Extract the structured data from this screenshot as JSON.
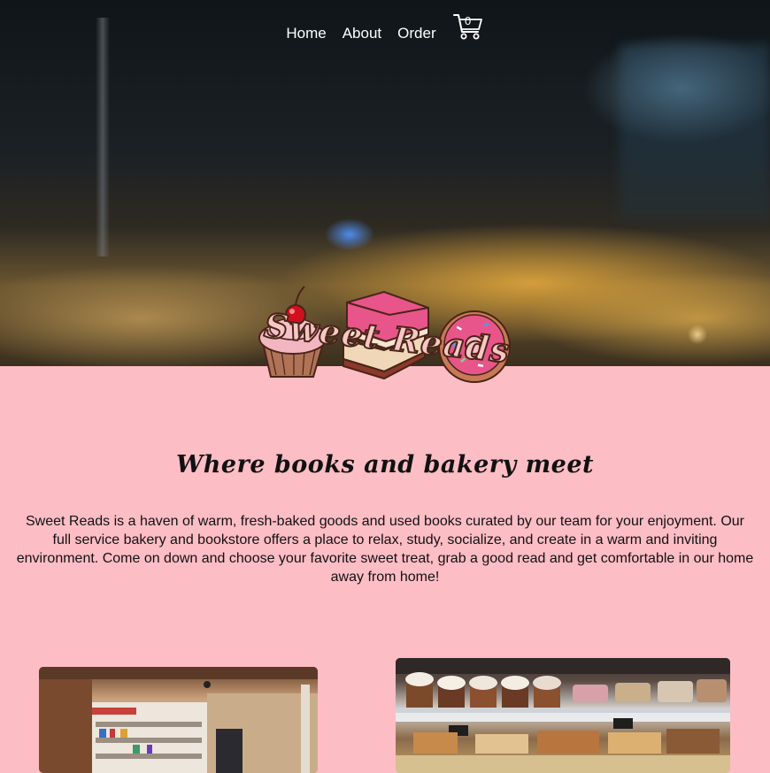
{
  "nav": {
    "items": [
      {
        "label": "Home"
      },
      {
        "label": "About"
      },
      {
        "label": "Order"
      }
    ],
    "cart_count": "0"
  },
  "logo": {
    "text": "Sweet Reads"
  },
  "main": {
    "tagline": "Where books and bakery meet",
    "intro": "Sweet Reads is a haven of warm, fresh-baked goods and used books curated by our team for your enjoyment. Our full service bakery and bookstore offers a place to relax, study, socialize, and create in a warm and inviting environment. Come on down and choose your favorite sweet treat, grab a good read and get comfortable in our home away from home!"
  },
  "colors": {
    "page_background": "#fdbdc5",
    "nav_text": "#ffffff",
    "body_text": "#111111"
  },
  "icons": [
    "shopping-cart-icon",
    "cupcake-icon",
    "book-stack-icon",
    "donut-icon"
  ]
}
